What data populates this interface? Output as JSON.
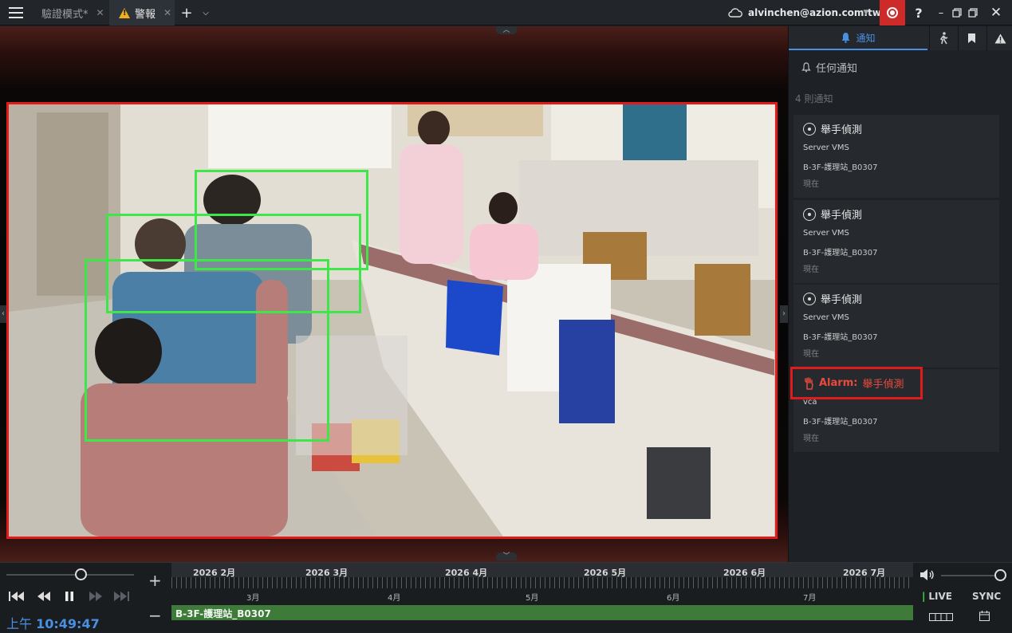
{
  "window": {
    "menu_icon": "hamburger-icon",
    "tabs": [
      {
        "label": "驗證模式*",
        "active": false
      },
      {
        "label": "警報",
        "active": true,
        "icon": "warning-icon"
      }
    ],
    "add_tab_icon": "plus-icon",
    "tab_dropdown_icon": "chevron-down-icon",
    "user": "alvinchen@azion.com.tw",
    "user_icon": "cloud-icon",
    "record_icon": "record-icon",
    "help_label": "?",
    "window_controls": [
      "minimize-icon",
      "restore-icon",
      "maximize-icon",
      "close-icon"
    ]
  },
  "notifications": {
    "tabs": [
      {
        "label": "通知",
        "icon": "bell-icon",
        "active": true
      },
      {
        "label": "",
        "icon": "person-walk-icon"
      },
      {
        "label": "",
        "icon": "bookmark-icon"
      },
      {
        "label": "",
        "icon": "alert-icon"
      }
    ],
    "filter": "任何通知",
    "count": "4 則通知",
    "items": [
      {
        "title": "舉手偵測",
        "source": "Server VMS",
        "camera": "B-3F-護理站_B0307",
        "time": "現在"
      },
      {
        "title": "舉手偵測",
        "source": "Server VMS",
        "camera": "B-3F-護理站_B0307",
        "time": "現在"
      },
      {
        "title": "舉手偵測",
        "source": "Server VMS",
        "camera": "B-3F-護理站_B0307",
        "time": "現在"
      },
      {
        "title_prefix": "Alarm:",
        "title": "舉手偵測",
        "source": "vca",
        "camera": "B-3F-護理站_B0307",
        "time": "現在"
      }
    ]
  },
  "playback": {
    "time_prefix": "上午",
    "time": "10:49:47",
    "buttons": [
      "skip-back-icon",
      "rewind-icon",
      "pause-icon",
      "fast-forward-icon",
      "skip-forward-icon"
    ],
    "zoom_in": "+",
    "zoom_out": "−"
  },
  "timeline": {
    "months": [
      "2026 2月",
      "2026 3月",
      "2026 4月",
      "2026 5月",
      "2026 6月",
      "2026 7月"
    ],
    "sub_labels": [
      "3月",
      "4月",
      "5月",
      "6月",
      "7月"
    ],
    "track_label": "B-3F-護理站_B0307",
    "live": "LIVE",
    "sync": "SYNC"
  },
  "colors": {
    "alarm_red": "#e01b1b",
    "detection_green": "#3ee64a",
    "accent_blue": "#4a90e2",
    "track_green": "#3e7a3a"
  }
}
